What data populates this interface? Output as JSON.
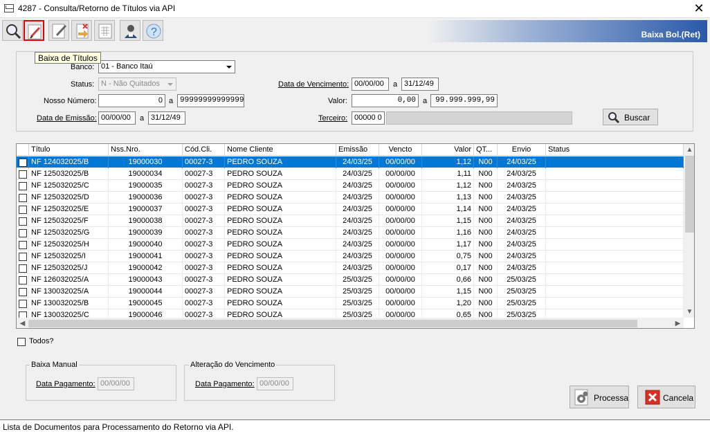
{
  "window": {
    "title": "4287 - Consulta/Retorno de Títulos via API",
    "close": "✕"
  },
  "toolbar": {
    "brand_label": "Baixa Bol.(Ret)",
    "tooltip": "Baixa de Títulos",
    "buttons": [
      {
        "icon": "magnifier-icon"
      },
      {
        "icon": "edit-pencil-icon"
      },
      {
        "icon": "document-pencil-icon"
      },
      {
        "icon": "delete-document-icon"
      },
      {
        "icon": "grid-document-icon"
      },
      {
        "icon": "user-icon"
      },
      {
        "icon": "help-icon"
      }
    ]
  },
  "filters": {
    "banco_label": "Banco:",
    "banco_value": "01 - Banco Itaú",
    "status_label": "Status:",
    "status_value": "N - Não Quitados",
    "nosso_label": "Nosso Número:",
    "nosso_from": "0",
    "nosso_sep": "a",
    "nosso_to": "99999999999999",
    "emissao_label": "Data de Emissão:",
    "emissao_from": "00/00/00",
    "emissao_sep": "a",
    "emissao_to": "31/12/49",
    "venc_label": "Data de Vencimento:",
    "venc_from": "00/00/00",
    "venc_sep": "a",
    "venc_to": "31/12/49",
    "valor_label": "Valor:",
    "valor_from": "0,00",
    "valor_sep": "a",
    "valor_to": "99.999.999,99",
    "terceiro_label": "Terceiro:",
    "terceiro_value": "00000 0",
    "buscar_label": "Buscar"
  },
  "grid": {
    "columns": [
      "Título",
      "Nss.Nro.",
      "Cód.Cli.",
      "Nome Cliente",
      "Emissão",
      "Vencto",
      "Valor",
      "QT...",
      "Envio",
      "Status"
    ],
    "rows": [
      {
        "titulo": "NF 124032025/B",
        "nss": "19000030",
        "cod": "00027-3",
        "nome": "PEDRO SOUZA",
        "emissao": "24/03/25",
        "vencto": "00/00/00",
        "valor": "1,12",
        "qt": "N00",
        "envio": "24/03/25",
        "status": ""
      },
      {
        "titulo": "NF 125032025/B",
        "nss": "19000034",
        "cod": "00027-3",
        "nome": "PEDRO SOUZA",
        "emissao": "24/03/25",
        "vencto": "00/00/00",
        "valor": "1,11",
        "qt": "N00",
        "envio": "24/03/25",
        "status": ""
      },
      {
        "titulo": "NF 125032025/C",
        "nss": "19000035",
        "cod": "00027-3",
        "nome": "PEDRO SOUZA",
        "emissao": "24/03/25",
        "vencto": "00/00/00",
        "valor": "1,12",
        "qt": "N00",
        "envio": "24/03/25",
        "status": ""
      },
      {
        "titulo": "NF 125032025/D",
        "nss": "19000036",
        "cod": "00027-3",
        "nome": "PEDRO SOUZA",
        "emissao": "24/03/25",
        "vencto": "00/00/00",
        "valor": "1,13",
        "qt": "N00",
        "envio": "24/03/25",
        "status": ""
      },
      {
        "titulo": "NF 125032025/E",
        "nss": "19000037",
        "cod": "00027-3",
        "nome": "PEDRO SOUZA",
        "emissao": "24/03/25",
        "vencto": "00/00/00",
        "valor": "1,14",
        "qt": "N00",
        "envio": "24/03/25",
        "status": ""
      },
      {
        "titulo": "NF 125032025/F",
        "nss": "19000038",
        "cod": "00027-3",
        "nome": "PEDRO SOUZA",
        "emissao": "24/03/25",
        "vencto": "00/00/00",
        "valor": "1,15",
        "qt": "N00",
        "envio": "24/03/25",
        "status": ""
      },
      {
        "titulo": "NF 125032025/G",
        "nss": "19000039",
        "cod": "00027-3",
        "nome": "PEDRO SOUZA",
        "emissao": "24/03/25",
        "vencto": "00/00/00",
        "valor": "1,16",
        "qt": "N00",
        "envio": "24/03/25",
        "status": ""
      },
      {
        "titulo": "NF 125032025/H",
        "nss": "19000040",
        "cod": "00027-3",
        "nome": "PEDRO SOUZA",
        "emissao": "24/03/25",
        "vencto": "00/00/00",
        "valor": "1,17",
        "qt": "N00",
        "envio": "24/03/25",
        "status": ""
      },
      {
        "titulo": "NF 125032025/I",
        "nss": "19000041",
        "cod": "00027-3",
        "nome": "PEDRO SOUZA",
        "emissao": "24/03/25",
        "vencto": "00/00/00",
        "valor": "0,75",
        "qt": "N00",
        "envio": "24/03/25",
        "status": ""
      },
      {
        "titulo": "NF 125032025/J",
        "nss": "19000042",
        "cod": "00027-3",
        "nome": "PEDRO SOUZA",
        "emissao": "24/03/25",
        "vencto": "00/00/00",
        "valor": "0,17",
        "qt": "N00",
        "envio": "24/03/25",
        "status": ""
      },
      {
        "titulo": "NF 126032025/A",
        "nss": "19000043",
        "cod": "00027-3",
        "nome": "PEDRO SOUZA",
        "emissao": "25/03/25",
        "vencto": "00/00/00",
        "valor": "0,66",
        "qt": "N00",
        "envio": "25/03/25",
        "status": ""
      },
      {
        "titulo": "NF 130032025/A",
        "nss": "19000044",
        "cod": "00027-3",
        "nome": "PEDRO SOUZA",
        "emissao": "25/03/25",
        "vencto": "00/00/00",
        "valor": "1,15",
        "qt": "N00",
        "envio": "25/03/25",
        "status": ""
      },
      {
        "titulo": "NF 130032025/B",
        "nss": "19000045",
        "cod": "00027-3",
        "nome": "PEDRO SOUZA",
        "emissao": "25/03/25",
        "vencto": "00/00/00",
        "valor": "1,20",
        "qt": "N00",
        "envio": "25/03/25",
        "status": ""
      },
      {
        "titulo": "NF 130032025/C",
        "nss": "19000046",
        "cod": "00027-3",
        "nome": "PEDRO SOUZA",
        "emissao": "25/03/25",
        "vencto": "00/00/00",
        "valor": "0,65",
        "qt": "N00",
        "envio": "25/03/25",
        "status": ""
      }
    ],
    "selected_index": 0
  },
  "todos_label": "Todos?",
  "baixa_manual": {
    "title": "Baixa Manual",
    "label": "Data Pagamento:",
    "value": "00/00/00"
  },
  "alteracao": {
    "title": "Alteração do Vencimento",
    "label": "Data Pagamento:",
    "value": "00/00/00"
  },
  "actions": {
    "processa": "Processa",
    "cancela": "Cancela"
  },
  "statusbar": {
    "text": "Lista de Documentos para Processamento do Retorno via API."
  }
}
